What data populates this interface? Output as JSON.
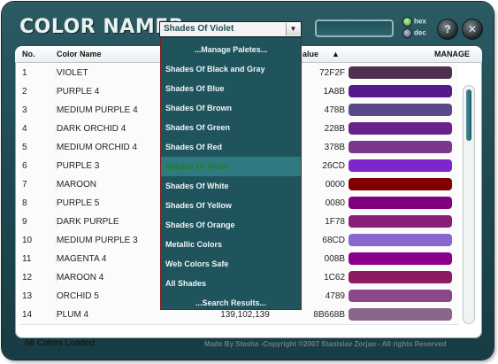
{
  "app": {
    "title": "COLOR NAMER"
  },
  "palette_select": {
    "value": "Shades Of Violet"
  },
  "search": {
    "value": ""
  },
  "format": {
    "hex_label": "hex",
    "dec_label": "dec",
    "selected": "hex"
  },
  "table": {
    "headers": {
      "no": "No.",
      "name": "Color Name",
      "value": "alue",
      "manage": "MANAGE"
    },
    "rows": [
      {
        "no": "1",
        "name": "VIOLET",
        "rgb": "",
        "hex": "72F2F",
        "color": "#4f2f4f"
      },
      {
        "no": "2",
        "name": "PURPLE 4",
        "rgb": "",
        "hex": "1A8B",
        "color": "#551a8b"
      },
      {
        "no": "3",
        "name": "MEDIUM PURPLE 4",
        "rgb": "",
        "hex": "478B",
        "color": "#5d478b"
      },
      {
        "no": "4",
        "name": "DARK ORCHID 4",
        "rgb": "",
        "hex": "228B",
        "color": "#68228b"
      },
      {
        "no": "5",
        "name": "MEDIUM ORCHID 4",
        "rgb": "",
        "hex": "378B",
        "color": "#7a378b"
      },
      {
        "no": "6",
        "name": "PURPLE 3",
        "rgb": "",
        "hex": "26CD",
        "color": "#7d26cd"
      },
      {
        "no": "7",
        "name": "MAROON",
        "rgb": "",
        "hex": "0000",
        "color": "#800000"
      },
      {
        "no": "8",
        "name": "PURPLE 5",
        "rgb": "",
        "hex": "0080",
        "color": "#800080"
      },
      {
        "no": "9",
        "name": "DARK PURPLE",
        "rgb": "",
        "hex": "1F78",
        "color": "#871f78"
      },
      {
        "no": "10",
        "name": "MEDIUM PURPLE 3",
        "rgb": "",
        "hex": "68CD",
        "color": "#8968cd"
      },
      {
        "no": "11",
        "name": "MAGENTA 4",
        "rgb": "",
        "hex": "008B",
        "color": "#8b008b"
      },
      {
        "no": "12",
        "name": "MAROON 4",
        "rgb": "",
        "hex": "1C62",
        "color": "#8b1c62"
      },
      {
        "no": "13",
        "name": "ORCHID 5",
        "rgb": "",
        "hex": "4789",
        "color": "#8b4789"
      },
      {
        "no": "14",
        "name": "PLUM 4",
        "rgb": "139,102,139",
        "hex": "8B668B",
        "color": "#8b668b"
      }
    ]
  },
  "dropdown": {
    "items": [
      {
        "label": "...Manage Paletes...",
        "center": true
      },
      {
        "label": "Shades Of Black and Gray"
      },
      {
        "label": "Shades Of Blue"
      },
      {
        "label": "Shades Of Brown"
      },
      {
        "label": "Shades Of Green"
      },
      {
        "label": "Shades Of Red"
      },
      {
        "label": "Shades Of Violet",
        "selected": true
      },
      {
        "label": "Shades Of White"
      },
      {
        "label": "Shades Of Yellow"
      },
      {
        "label": "Shades Of Orange"
      },
      {
        "label": "Metallic Colors"
      },
      {
        "label": "Web Colors Safe"
      },
      {
        "label": "All Shades"
      },
      {
        "label": "...Search Results...",
        "center": true
      }
    ]
  },
  "status": {
    "loaded": "68 Colors Loaded",
    "credit": "Made By Stasha -Copyright ©2007 Stanislav Zorjan - All rights Reserved"
  },
  "colors": {
    "window": "#1f4a52",
    "dropdown_bg": "#1f545d",
    "dropdown_selected": "#2f7a80"
  }
}
